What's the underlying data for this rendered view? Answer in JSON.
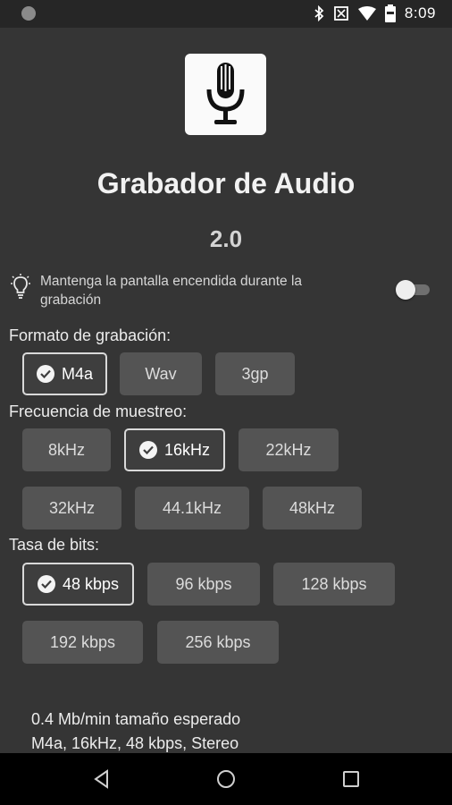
{
  "status_bar": {
    "time": "8:09",
    "icons": [
      "notification-dot-icon",
      "bluetooth-icon",
      "vibrate-icon",
      "wifi-icon",
      "battery-icon"
    ]
  },
  "app": {
    "title": "Grabador de Audio",
    "version": "2.0",
    "icon": "microphone-icon"
  },
  "keep_screen": {
    "label": "Mantenga la pantalla encendida durante la grabación",
    "enabled": false,
    "icon": "lightbulb-icon"
  },
  "format": {
    "label": "Formato de grabación:",
    "options": [
      "M4a",
      "Wav",
      "3gp"
    ],
    "selected": "M4a"
  },
  "sample_rate": {
    "label": "Frecuencia de muestreo:",
    "options": [
      "8kHz",
      "16kHz",
      "22kHz",
      "32kHz",
      "44.1kHz",
      "48kHz"
    ],
    "selected": "16kHz"
  },
  "bitrate": {
    "label": "Tasa de bits:",
    "options": [
      "48 kbps",
      "96 kbps",
      "128 kbps",
      "192 kbps",
      "256 kbps"
    ],
    "selected": "48 kbps"
  },
  "summary": {
    "size": "0.4 Mb/min tamaño esperado",
    "settings": "M4a, 16kHz, 48 kbps, Stereo"
  },
  "nav": [
    "back-icon",
    "home-icon",
    "recents-icon"
  ]
}
